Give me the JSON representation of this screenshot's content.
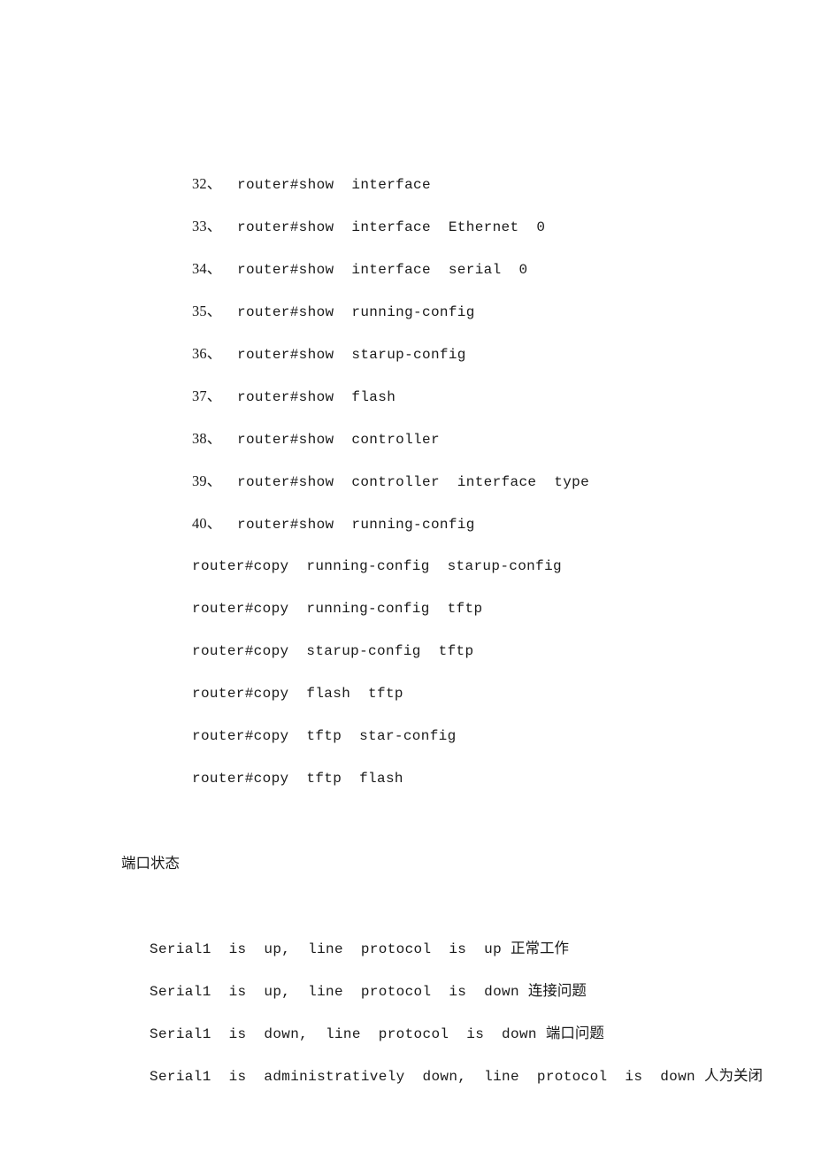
{
  "document": {
    "command_list": [
      {
        "number": "32、",
        "command": "router#show  interface"
      },
      {
        "number": "33、",
        "command": "router#show  interface  Ethernet  0"
      },
      {
        "number": "34、",
        "command": "router#show  interface  serial  0"
      },
      {
        "number": "35、",
        "command": "router#show  running-config"
      },
      {
        "number": "36、",
        "command": "router#show  starup-config"
      },
      {
        "number": "37、",
        "command": "router#show  flash"
      },
      {
        "number": "38、",
        "command": "router#show  controller"
      },
      {
        "number": "39、",
        "command": "router#show  controller  interface  type"
      },
      {
        "number": "40、",
        "command": "router#show  running-config"
      }
    ],
    "copy_commands": [
      "router#copy  running-config  starup-config",
      "router#copy  running-config  tftp",
      "router#copy  starup-config  tftp",
      "router#copy  flash  tftp",
      "router#copy  tftp  star-config",
      "router#copy  tftp  flash"
    ],
    "port_status": {
      "heading": "端口状态",
      "lines": [
        {
          "text": "Serial1  is  up,  line  protocol  is  up ",
          "note": "正常工作"
        },
        {
          "text": "Serial1  is  up,  line  protocol  is  down ",
          "note": "连接问题"
        },
        {
          "text": "Serial1  is  down,  line  protocol  is  down ",
          "note": "端口问题"
        },
        {
          "text": "Serial1  is  administratively  down,  line  protocol  is  down ",
          "note": "人为关闭"
        }
      ]
    }
  }
}
